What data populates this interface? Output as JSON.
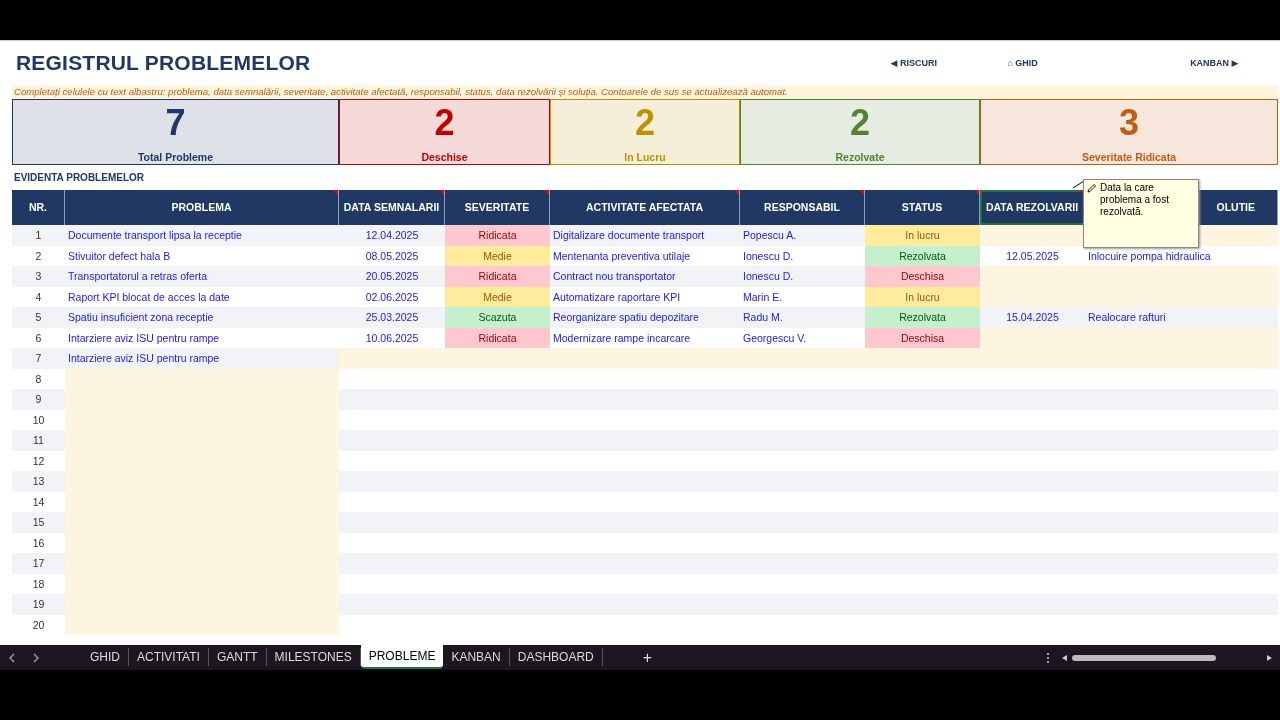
{
  "title": "REGISTRUL PROBLEMELOR",
  "nav": [
    {
      "label": "◀ RISCURI"
    },
    {
      "label": "⌂ GHID"
    },
    {
      "label": "KANBAN ▶"
    }
  ],
  "instructions": "Completați celulele cu text albastru: problema, data semnalării, severitate, activitate afectată, responsabil, status, data rezolvării și soluția. Contoarele de sus se actualizează automat.",
  "kpis": [
    {
      "value": "7",
      "label": "Total Probleme",
      "color": "#1f3864"
    },
    {
      "value": "2",
      "label": "Deschise",
      "color": "#c00000"
    },
    {
      "value": "2",
      "label": "In Lucru",
      "color": "#bf9000"
    },
    {
      "value": "2",
      "label": "Rezolvate",
      "color": "#548235"
    },
    {
      "value": "3",
      "label": "Severitate Ridicata",
      "color": "#c55a11"
    }
  ],
  "section": "EVIDENTA PROBLEMELOR",
  "columns": [
    {
      "label": "NR.",
      "note": false,
      "selected": false
    },
    {
      "label": "PROBLEMA",
      "note": true,
      "selected": false
    },
    {
      "label": "DATA SEMNALARII",
      "note": true,
      "selected": false
    },
    {
      "label": "SEVERITATE",
      "note": true,
      "selected": false
    },
    {
      "label": "ACTIVITATE AFECTATA",
      "note": true,
      "selected": false
    },
    {
      "label": "RESPONSABIL",
      "note": true,
      "selected": false
    },
    {
      "label": "STATUS",
      "note": true,
      "selected": false
    },
    {
      "label": "DATA REZOLVARII",
      "note": true,
      "selected": true
    },
    {
      "label": "OLUTIE",
      "note": false,
      "selected": false
    }
  ],
  "comment": {
    "text": "Data la care problema a fost rezolvată."
  },
  "rows": [
    {
      "kind": "filled",
      "nr": "1",
      "problema": "Documente transport lipsa la receptie",
      "data_semnalarii": "12.04.2025",
      "severitate": {
        "label": "Ridicata",
        "kind": "high"
      },
      "activitate": "Digitalizare documente transport",
      "responsabil": "Popescu A.",
      "status": {
        "label": "In lucru",
        "kind": "in_progress"
      }
    },
    {
      "kind": "filled",
      "nr": "2",
      "problema": "Stivuitor defect hala B",
      "data_semnalarii": "08.05.2025",
      "severitate": {
        "label": "Medie",
        "kind": "medium"
      },
      "activitate": "Mentenanta preventiva utilaje",
      "responsabil": "Ionescu D.",
      "status": {
        "label": "Rezolvata",
        "kind": "resolved"
      },
      "data_rezolvarii": "12.05.2025",
      "solutie": "Inlocuire pompa hidraulica"
    },
    {
      "kind": "filled",
      "nr": "3",
      "problema": "Transportatorul a retras oferta",
      "data_semnalarii": "20.05.2025",
      "severitate": {
        "label": "Ridicata",
        "kind": "high"
      },
      "activitate": "Contract nou transportator",
      "responsabil": "Ionescu D.",
      "status": {
        "label": "Deschisa",
        "kind": "open"
      }
    },
    {
      "kind": "filled",
      "nr": "4",
      "problema": "Raport KPI blocat de acces la date",
      "data_semnalarii": "02.06.2025",
      "severitate": {
        "label": "Medie",
        "kind": "medium"
      },
      "activitate": "Automatizare raportare KPI",
      "responsabil": "Marin E.",
      "status": {
        "label": "In lucru",
        "kind": "in_progress"
      }
    },
    {
      "kind": "filled",
      "nr": "5",
      "problema": "Spatiu insuficient zona receptie",
      "data_semnalarii": "25.03.2025",
      "severitate": {
        "label": "Scazuta",
        "kind": "low"
      },
      "activitate": "Reorganizare spatiu depozitare",
      "responsabil": "Radu M.",
      "status": {
        "label": "Rezolvata",
        "kind": "resolved"
      },
      "data_rezolvarii": "15.04.2025",
      "solutie": "Realocare rafturi"
    },
    {
      "kind": "filled",
      "nr": "6",
      "problema": "Intarziere aviz ISU pentru rampe",
      "data_semnalarii": "10.06.2025",
      "severitate": {
        "label": "Ridicata",
        "kind": "high"
      },
      "activitate": "Modernizare rampe incarcare",
      "responsabil": "Georgescu V.",
      "status": {
        "label": "Deschisa",
        "kind": "open"
      }
    },
    {
      "kind": "partial",
      "nr": "7",
      "problema": "Intarziere aviz ISU pentru rampe"
    },
    {
      "kind": "blank",
      "nr": "8"
    },
    {
      "kind": "blank",
      "nr": "9"
    },
    {
      "kind": "blank",
      "nr": "10"
    },
    {
      "kind": "blank",
      "nr": "11"
    },
    {
      "kind": "blank",
      "nr": "12"
    },
    {
      "kind": "blank",
      "nr": "13"
    },
    {
      "kind": "blank",
      "nr": "14"
    },
    {
      "kind": "blank",
      "nr": "15"
    },
    {
      "kind": "blank",
      "nr": "16"
    },
    {
      "kind": "blank",
      "nr": "17"
    },
    {
      "kind": "blank",
      "nr": "18"
    },
    {
      "kind": "blank",
      "nr": "19"
    },
    {
      "kind": "blank",
      "nr": "20"
    }
  ],
  "sheet_tabs": [
    {
      "label": "GHID",
      "selected": false
    },
    {
      "label": "ACTIVITATI",
      "selected": false
    },
    {
      "label": "GANTT",
      "selected": false
    },
    {
      "label": "MILESTONES",
      "selected": false
    },
    {
      "label": "PROBLEME",
      "selected": true
    },
    {
      "label": "KANBAN",
      "selected": false
    },
    {
      "label": "DASHBOARD",
      "selected": false
    }
  ],
  "add_sheet": "+"
}
